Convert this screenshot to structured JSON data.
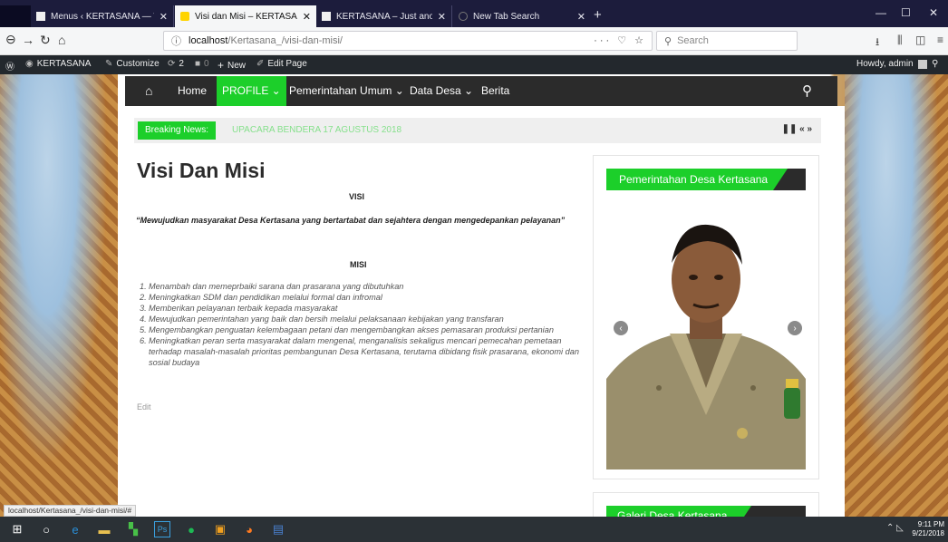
{
  "browser": {
    "tabs": [
      {
        "title": "Menus ‹ KERTASANA — WordP",
        "active": false
      },
      {
        "title": "Visi dan Misi – KERTASANA",
        "active": true
      },
      {
        "title": "KERTASANA – Just another Wo",
        "active": false
      },
      {
        "title": "New Tab Search",
        "active": false
      }
    ],
    "url_host": "localhost",
    "url_path": "/Kertasana_/visi-dan-misi/",
    "search_placeholder": "Search",
    "status_url": "localhost/Kertasana_/visi-dan-misi/#"
  },
  "adminbar": {
    "site": "KERTASANA",
    "customize": "Customize",
    "updates": "2",
    "comments": "0",
    "new": "New",
    "edit": "Edit Page",
    "howdy": "Howdy, admin"
  },
  "sitenav": {
    "items": [
      "Home",
      "PROFILE ⌄",
      "Pemerintahan Umum ⌄",
      "Data Desa ⌄",
      "Berita"
    ]
  },
  "breaking": {
    "label": "Breaking News:",
    "headline": "UPACARA BENDERA 17 AGUSTUS 2018"
  },
  "page": {
    "title": "Visi Dan Misi",
    "visi_heading": "VISI",
    "visi_text": "“Mewujudkan masyarakat Desa Kertasana yang bertartabat dan sejahtera dengan mengedepankan pelayanan”",
    "misi_heading": "MISI",
    "misi": [
      "Menambah dan memeprbaiki sarana dan prasarana yang dibutuhkan",
      "Meningkatkan SDM dan pendidikan melalui formal dan infromal",
      "Memberikan pelayanan terbaik kepada masyarakat",
      "Mewujudkan pemerintahan yang baik dan bersih melalui pelaksanaan kebijakan yang transfaran",
      "Mengembangkan penguatan kelembagaan petani dan mengembangkan akses pemasaran produksi pertanian",
      "Meningkatkan peran serta masyarakat dalam mengenal, menganalisis sekaligus mencari pemecahan pemetaan terhadap masalah-masalah prioritas pembangunan Desa Kertasana, terutama dibidang fisik prasarana, ekonomi dan sosial budaya"
    ],
    "edit_link": "Edit"
  },
  "sidebar": {
    "widget1_title": "Pemerintahan Desa Kertasana",
    "widget2_title": "Galeri Desa Kertasana"
  },
  "taskbar": {
    "time": "9:11 PM",
    "date": "9/21/2018"
  },
  "colors": {
    "accent_green": "#1ccf2a",
    "nav_dark": "#2b2b2b",
    "tabstrip": "#1c1c3c"
  }
}
